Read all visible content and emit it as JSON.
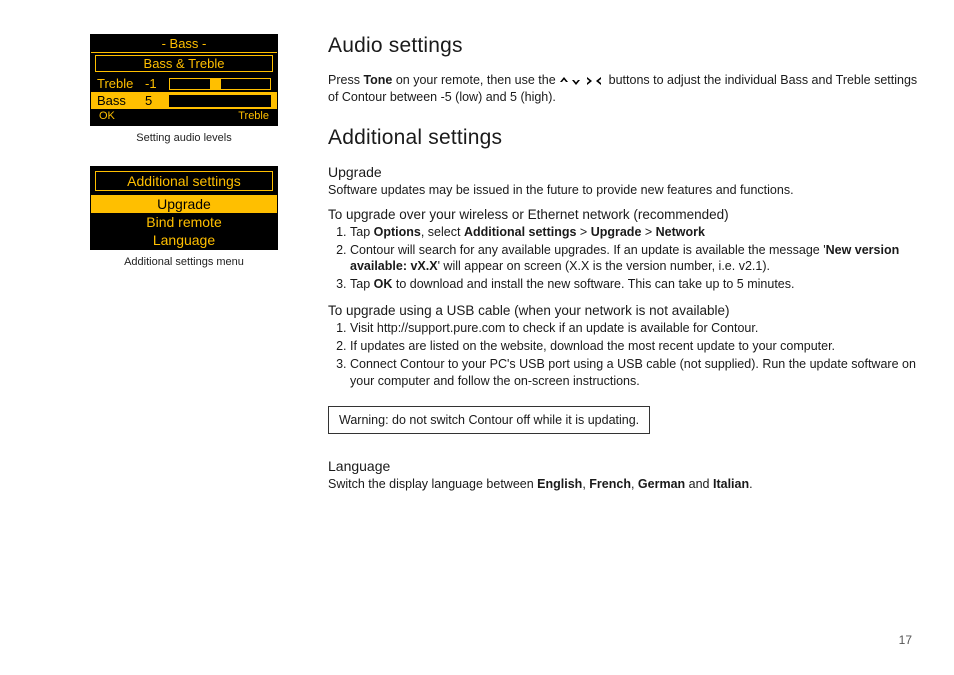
{
  "device1": {
    "title": "- Bass -",
    "subtitle": "Bass & Treble",
    "rows": [
      {
        "label": "Treble",
        "value": "-1"
      },
      {
        "label": "Bass",
        "value": "5"
      }
    ],
    "footer_left": "OK",
    "footer_right": "Treble",
    "caption": "Setting audio levels"
  },
  "device2": {
    "header": "Additional settings",
    "rows": [
      "Upgrade",
      "Bind remote",
      "Language"
    ],
    "caption": "Additional settings menu"
  },
  "right": {
    "h1a": "Audio settings",
    "p1_a": "Press ",
    "p1_b_bold": "Tone",
    "p1_c": " on your remote, then use the ",
    "p1_d": " buttons to adjust the individual Bass and Treble settings of Contour between -5 (low) and 5 (high).",
    "h1b": "Additional settings",
    "upgrade_h": "Upgrade",
    "upgrade_p": "Software updates may be issued in the future to provide new features and functions.",
    "net_h": "To upgrade over your wireless or Ethernet network (recommended)",
    "net_steps": {
      "s1_a": "Tap ",
      "s1_b": "Options",
      "s1_c": ", select ",
      "s1_d": "Additional settings",
      "s1_e": " > ",
      "s1_f": "Upgrade",
      "s1_g": " > ",
      "s1_h": "Network",
      "s2_a": "Contour will search for any available upgrades. If an update is available the message '",
      "s2_b": "New version available: vX.X",
      "s2_c": "' will appear on screen (X.X is the version number, i.e. v2.1).",
      "s3_a": "Tap ",
      "s3_b": "OK",
      "s3_c": " to download and install the new software. This can take up to 5 minutes."
    },
    "usb_h": "To upgrade using a USB cable (when your network is not available)",
    "usb_steps": {
      "s1": "Visit http://support.pure.com to check if an update is available for Contour.",
      "s2": "If updates are listed on the website, download the most recent update to your computer.",
      "s3": "Connect Contour to your PC's USB port using a USB cable (not supplied). Run the update software on your computer and follow the on-screen instructions."
    },
    "warning": "Warning: do not switch Contour off while it is updating.",
    "lang_h": "Language",
    "lang_a": "Switch the display language between ",
    "lang_b1": "English",
    "lang_c1": ", ",
    "lang_b2": "French",
    "lang_c2": ", ",
    "lang_b3": "German",
    "lang_c3": " and ",
    "lang_b4": "Italian",
    "lang_c4": "."
  },
  "pageno": "17"
}
